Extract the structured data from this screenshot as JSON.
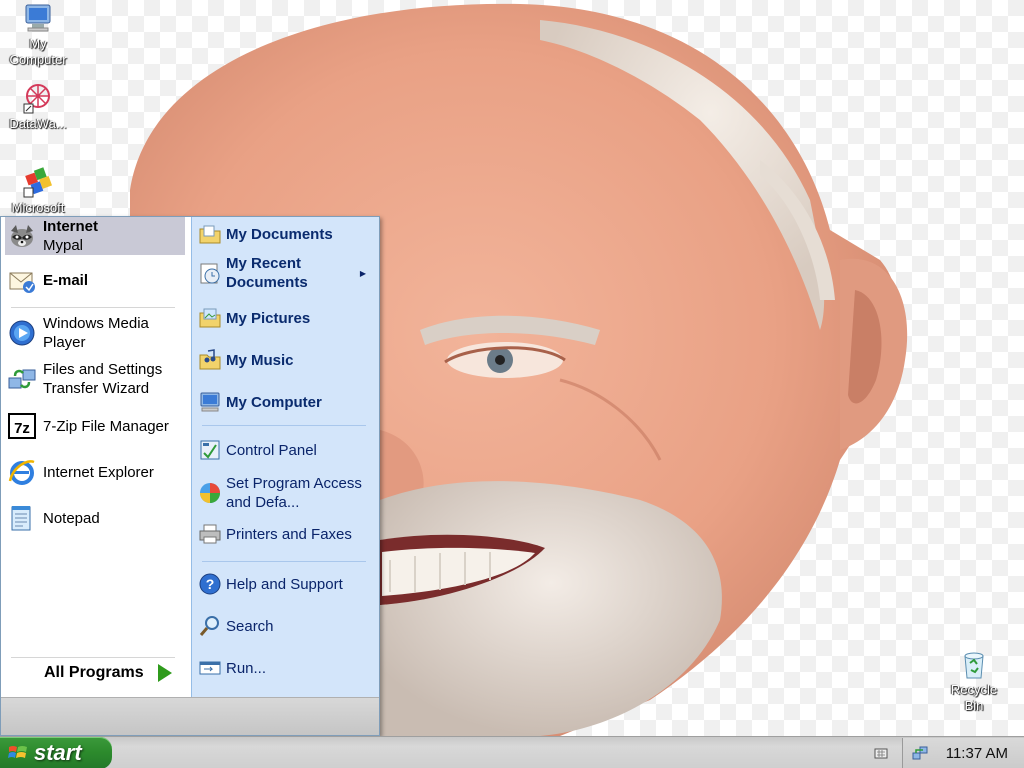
{
  "desktop": {
    "icons": [
      {
        "name": "my-computer",
        "label": "My\nComputer",
        "icon": "computer-icon"
      },
      {
        "name": "datawatch",
        "label": "DataWa...",
        "icon": "datawatch-shortcut-icon"
      },
      {
        "name": "microsoft",
        "label": "Microsoft",
        "icon": "microsoft-shortcut-icon"
      },
      {
        "name": "recycle-bin",
        "label": "Recycle\nBin",
        "icon": "recycle-bin-icon"
      }
    ]
  },
  "start_menu": {
    "pinned": [
      {
        "title": "Internet",
        "subtitle": "Mypal",
        "icon": "mypal-raccoon-icon"
      },
      {
        "title": "E-mail",
        "icon": "email-icon"
      }
    ],
    "recent": [
      {
        "line1": "Windows Media",
        "line2": "Player",
        "icon": "media-player-icon"
      },
      {
        "line1": "Files and Settings",
        "line2": "Transfer Wizard",
        "icon": "transfer-wizard-icon"
      },
      {
        "line1": "7-Zip File Manager",
        "icon": "7zip-icon"
      },
      {
        "line1": "Internet Explorer",
        "icon": "internet-explorer-icon"
      },
      {
        "line1": "Notepad",
        "icon": "notepad-icon"
      }
    ],
    "all_programs": "All Programs",
    "places": [
      {
        "label": "My Documents",
        "icon": "folder-documents-icon"
      },
      {
        "line1": "My Recent",
        "line2": "Documents",
        "icon": "recent-documents-icon"
      },
      {
        "label": "My Pictures",
        "icon": "folder-pictures-icon"
      },
      {
        "label": "My Music",
        "icon": "folder-music-icon"
      },
      {
        "label": "My Computer",
        "icon": "computer-icon"
      }
    ],
    "system": [
      {
        "label": "Control Panel",
        "icon": "control-panel-icon"
      },
      {
        "line1": "Set Program",
        "line2": "Access and Defa...",
        "icon": "set-program-access-icon"
      },
      {
        "label": "Printers and Faxes",
        "icon": "printer-icon"
      }
    ],
    "tools": [
      {
        "label": "Help and Support",
        "icon": "help-icon"
      },
      {
        "label": "Search",
        "icon": "search-icon"
      },
      {
        "label": "Run...",
        "icon": "run-icon"
      }
    ]
  },
  "taskbar": {
    "start_label": "start",
    "clock": "11:37 AM"
  },
  "colors": {
    "start_green": "#2c8a2c",
    "menu_right_bg": "#d3e5fa",
    "menu_highlight": "#c9c9d6",
    "places_text": "#0a246a"
  }
}
